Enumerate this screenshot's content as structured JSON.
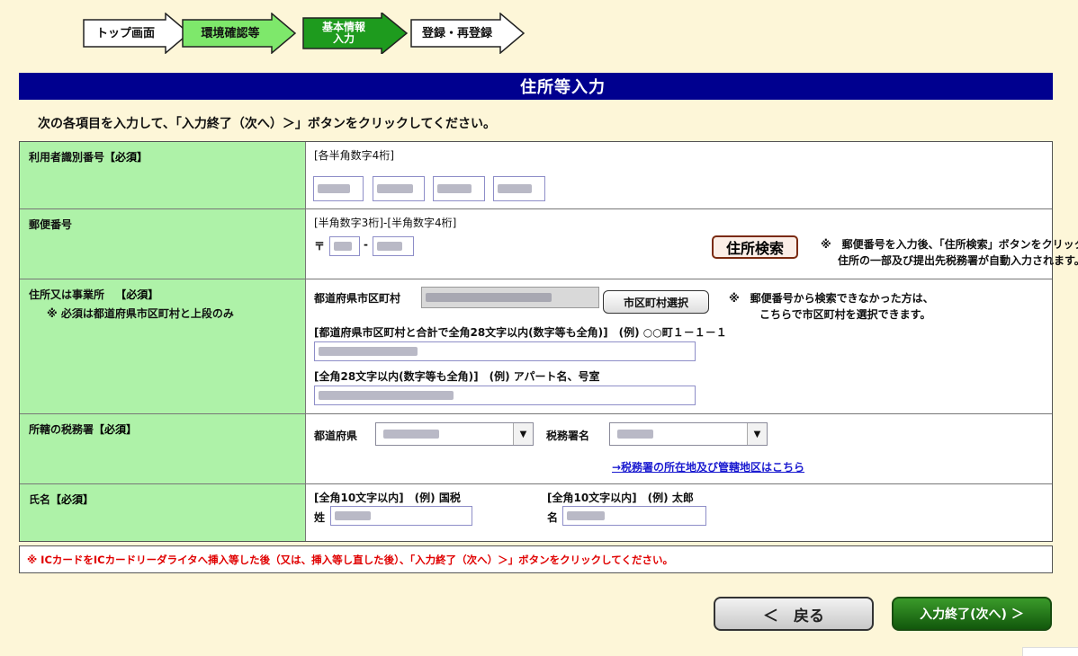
{
  "steps": [
    {
      "label": "トップ画面",
      "state": "done"
    },
    {
      "label": "環境確認等",
      "state": "done"
    },
    {
      "label_line1": "基本情報",
      "label_line2": "入力",
      "state": "current"
    },
    {
      "label": "登録・再登録",
      "state": "todo"
    }
  ],
  "colors": {
    "done": "#7ee86b",
    "current": "#1e9b1e",
    "todo": "#ffffff",
    "header": "#00008f",
    "label_bg": "#aef2a8"
  },
  "title": "住所等入力",
  "instruction": "次の各項目を入力して、「入力終了（次へ）＞」ボタンをクリックしてください。",
  "rows": {
    "user_id": {
      "label": "利用者識別番号",
      "required": "【必須】",
      "hint": "[各半角数字4桁]"
    },
    "postal": {
      "label": "郵便番号",
      "hint": "[半角数字3桁]-[半角数字4桁]",
      "mark": "〒",
      "dash": "-",
      "search_button": "住所検索",
      "note1": "※　郵便番号を入力後、「住所検索」ボタンをクリックすると、",
      "note2": "住所の一部及び提出先税務署が自動入力されます。"
    },
    "address": {
      "label": "住所又は事業所",
      "required": "【必須】",
      "sub_note": "※ 必須は都道府県市区町村と上段のみ",
      "city_label": "都道府県市区町村",
      "city_button": "市区町村選択",
      "city_note1": "※　郵便番号から検索できなかった方は、",
      "city_note2": "こちらで市区町村を選択できます。",
      "line1_hint": "[都道府県市区町村と合計で全角28文字以内(数字等も全角)]　(例) ○○町１－１－１",
      "line2_hint": "[全角28文字以内(数字等も全角)]　(例) アパート名、号室"
    },
    "tax_office": {
      "label": "所轄の税務署",
      "required": "【必須】",
      "pref_label": "都道府県",
      "office_label": "税務署名",
      "link": "→税務署の所在地及び管轄地区はこちら"
    },
    "name": {
      "label": "氏名",
      "required": "【必須】",
      "last_hint": "[全角10文字以内]　(例) 国税",
      "first_hint": "[全角10文字以内]　(例) 太郎",
      "last_label": "姓",
      "first_label": "名"
    }
  },
  "warning": "※ ICカードをICカードリーダライタへ挿入等した後（又は、挿入等し直した後）、「入力終了（次へ）＞」ボタンをクリックしてください。",
  "buttons": {
    "back": "＜　戻る",
    "next": "入力終了(次へ) ＞"
  }
}
